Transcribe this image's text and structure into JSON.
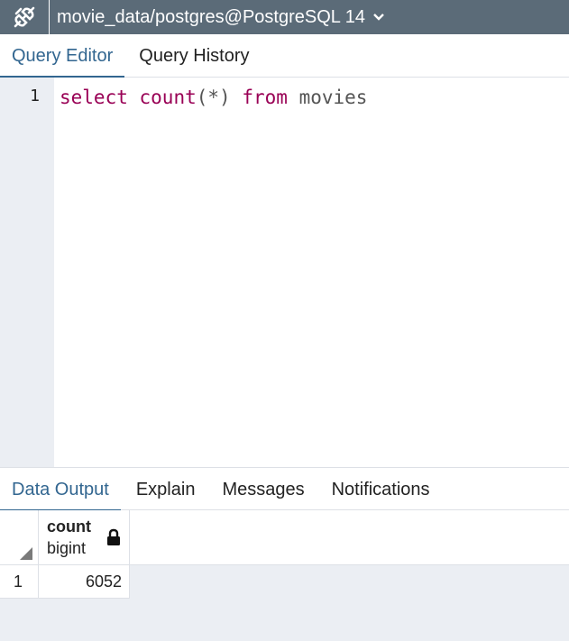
{
  "connection": {
    "title": "movie_data/postgres@PostgreSQL 14",
    "icon": "connection-plug-icon",
    "dropdown_icon": "chevron-down-icon"
  },
  "editor_tabs": [
    {
      "label": "Query Editor",
      "active": true
    },
    {
      "label": "Query History",
      "active": false
    }
  ],
  "editor": {
    "line_number": "1",
    "code": {
      "kw1": "select",
      "fn": "count",
      "args": "(*)",
      "kw2": "from",
      "table": "movies"
    }
  },
  "output_tabs": [
    {
      "label": "Data Output",
      "active": true
    },
    {
      "label": "Explain",
      "active": false
    },
    {
      "label": "Messages",
      "active": false
    },
    {
      "label": "Notifications",
      "active": false
    }
  ],
  "results": {
    "columns": [
      {
        "name": "count",
        "type": "bigint",
        "icon": "lock-icon"
      }
    ],
    "rows": [
      {
        "row_number": "1",
        "values": [
          "6052"
        ]
      }
    ]
  },
  "colors": {
    "topbar": "#5b6b78",
    "accent": "#326690",
    "keyword": "#990055",
    "gutter": "#ebeef3"
  }
}
